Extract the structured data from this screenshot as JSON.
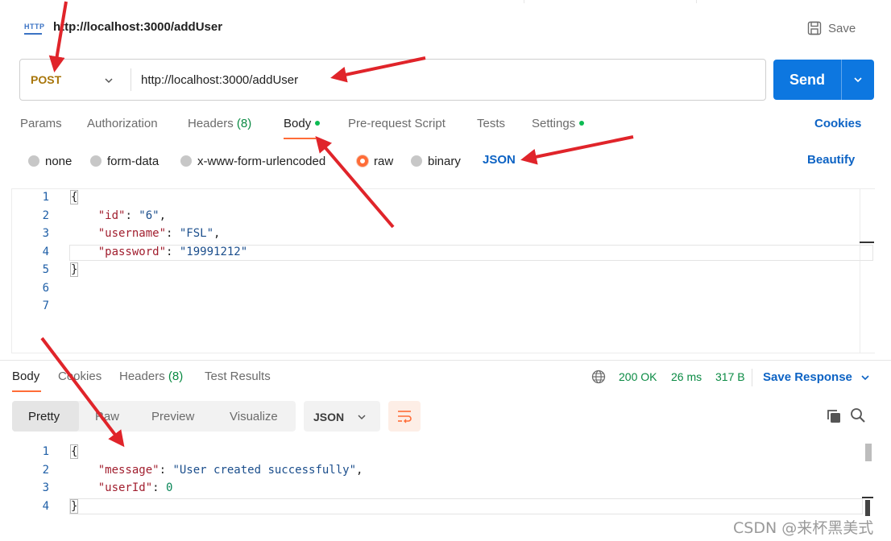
{
  "request": {
    "title": "http://localhost:3000/addUser",
    "save_label": "Save",
    "method": "POST",
    "url": "http://localhost:3000/addUser",
    "send_label": "Send",
    "http_badge": "HTTP"
  },
  "request_tabs": {
    "params": "Params",
    "authorization": "Authorization",
    "headers": "Headers",
    "headers_count": "(8)",
    "body": "Body",
    "prerequest": "Pre-request Script",
    "tests": "Tests",
    "settings": "Settings",
    "cookies": "Cookies"
  },
  "body_types": {
    "none": "none",
    "form_data": "form-data",
    "urlencoded": "x-www-form-urlencoded",
    "raw": "raw",
    "binary": "binary",
    "language": "JSON",
    "beautify": "Beautify"
  },
  "request_body": {
    "line_numbers": [
      "1",
      "2",
      "3",
      "4",
      "5",
      "6",
      "7"
    ],
    "open_brace": "{",
    "close_brace": "}",
    "fields": [
      {
        "key": "\"id\"",
        "value": "\"6\"",
        "trail": ","
      },
      {
        "key": "\"username\"",
        "value": "\"FSL\"",
        "trail": ","
      },
      {
        "key": "\"password\"",
        "value": "\"19991212\"",
        "trail": ""
      }
    ]
  },
  "response_tabs": {
    "body": "Body",
    "cookies": "Cookies",
    "headers": "Headers",
    "headers_count": "(8)",
    "test_results": "Test Results"
  },
  "response_status": {
    "status": "200 OK",
    "time": "26 ms",
    "size": "317 B",
    "save_response": "Save Response"
  },
  "response_view": {
    "pretty": "Pretty",
    "raw": "Raw",
    "preview": "Preview",
    "visualize": "Visualize",
    "format": "JSON"
  },
  "response_body": {
    "line_numbers": [
      "1",
      "2",
      "3",
      "4"
    ],
    "open_brace": "{",
    "close_brace": "}",
    "message_key": "\"message\"",
    "message_value": "\"User created successfully\"",
    "userid_key": "\"userId\"",
    "userid_value": "0"
  },
  "watermark": "CSDN @来杯黑美式",
  "colors": {
    "accent": "#ff6c37",
    "send": "#0d77e0",
    "link": "#0d63c4",
    "status_ok": "#0a8a43",
    "annotation_arrow": "#e0242a",
    "method_post": "#a8760b"
  }
}
